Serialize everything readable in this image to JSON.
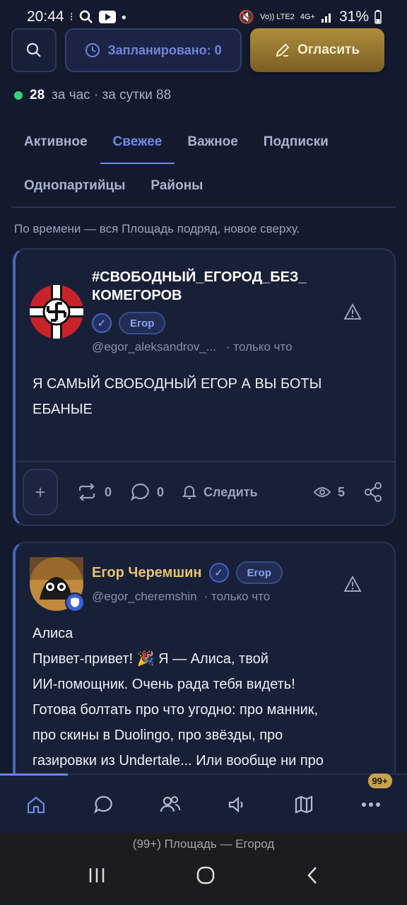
{
  "status_bar": {
    "time": "20:44",
    "battery": "31%",
    "volte": "Vo)) LTE2",
    "net": "4G+"
  },
  "toolbar": {
    "scheduled_label": "Запланировано: 0",
    "announce_label": "Огласить"
  },
  "online": {
    "count": "28",
    "rest": "за час · за сутки 88"
  },
  "tabs": {
    "row1": [
      "Активное",
      "Свежее",
      "Важное",
      "Подписки"
    ],
    "row2": [
      "Однопартийцы",
      "Районы"
    ],
    "active": "Свежее"
  },
  "hint": "По времени — вся Площадь подряд, новое сверху.",
  "posts": [
    {
      "author": "#СВОБОДНЫЙ_ЕГОРОД_БЕЗ_КОМЕГОРОВ",
      "author_line1": "#СВОБОДНЫЙ_ЕГОРОД_БЕЗ_",
      "author_line2": "КОМЕГОРОВ",
      "badge": "Егор",
      "handle": "@egor_aleksandrov_...",
      "time": "· только что",
      "text": "Я САМЫЙ СВОБОДНЫЙ ЕГОР А ВЫ БОТЫ ЕБАНЫЕ",
      "reposts": "0",
      "comments": "0",
      "follow_label": "Следить",
      "views": "5"
    },
    {
      "author": "Егор Черемшин",
      "badge": "Егор",
      "handle": "@egor_cheremshin",
      "time": "· только что",
      "text_lines": [
        "Алиса",
        "Привет-привет! 🎉 Я — Алиса, твой",
        "ИИ-помощник. Очень рада тебя видеть!",
        "Готова болтать про что угодно: про манник,",
        "про скины в Duolingo, про звёзды, про",
        "газировки из Undertale... Или вообще ни про"
      ]
    }
  ],
  "bottom_nav": {
    "more_badge": "99+"
  },
  "system": {
    "window_title": "(99+) Площадь — Егород"
  },
  "colors": {
    "accent": "#6f8be6",
    "gold": "#b08e3c",
    "online": "#3ecf7a",
    "background": "#141a2e"
  }
}
